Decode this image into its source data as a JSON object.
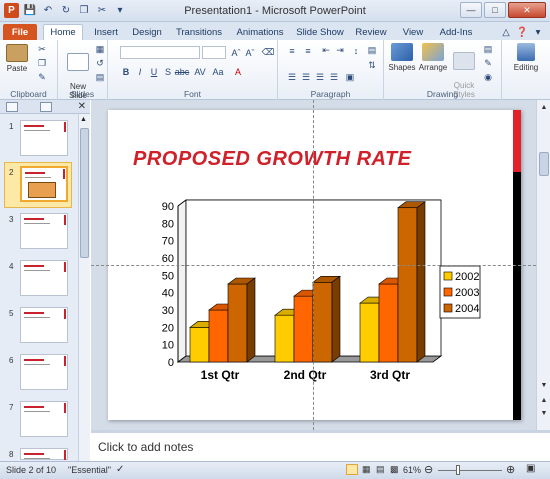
{
  "window": {
    "title": "Presentation1  -  Microsoft PowerPoint"
  },
  "tabs": [
    "File",
    "Home",
    "Insert",
    "Design",
    "Transitions",
    "Animations",
    "Slide Show",
    "Review",
    "View",
    "Add-Ins"
  ],
  "ribbon": {
    "groups": [
      "Clipboard",
      "Slides",
      "Font",
      "Paragraph",
      "Drawing"
    ],
    "paste_label": "Paste",
    "new_slide_label": "New\nSlide",
    "shapes_label": "Shapes",
    "arrange_label": "Arrange",
    "quick_styles_label": "Quick\nStyles",
    "editing_label": "Editing"
  },
  "slides_pane": {
    "numbers": [
      "1",
      "2",
      "3",
      "4",
      "5",
      "6",
      "7",
      "8"
    ],
    "selected": 2
  },
  "slide": {
    "title": "PROPOSED GROWTH RATE"
  },
  "chart_data": {
    "type": "bar",
    "categories": [
      "1st Qtr",
      "2nd Qtr",
      "3rd Qtr"
    ],
    "series": [
      {
        "name": "2002",
        "values": [
          20,
          27,
          34
        ],
        "color": "#ffcc00"
      },
      {
        "name": "2003",
        "values": [
          30,
          38,
          45
        ],
        "color": "#ff6600"
      },
      {
        "name": "2004",
        "values": [
          45,
          46,
          89
        ],
        "color": "#cc6600"
      }
    ],
    "ylim": [
      0,
      90
    ],
    "yticks": [
      "0",
      "10",
      "20",
      "30",
      "40",
      "50",
      "60",
      "70",
      "80",
      "90"
    ],
    "legend": "right",
    "grid": true
  },
  "notes": {
    "placeholder": "Click to add notes"
  },
  "status": {
    "slide_info": "Slide 2 of 10",
    "theme": "\"Essential\"",
    "zoom": "61%"
  }
}
